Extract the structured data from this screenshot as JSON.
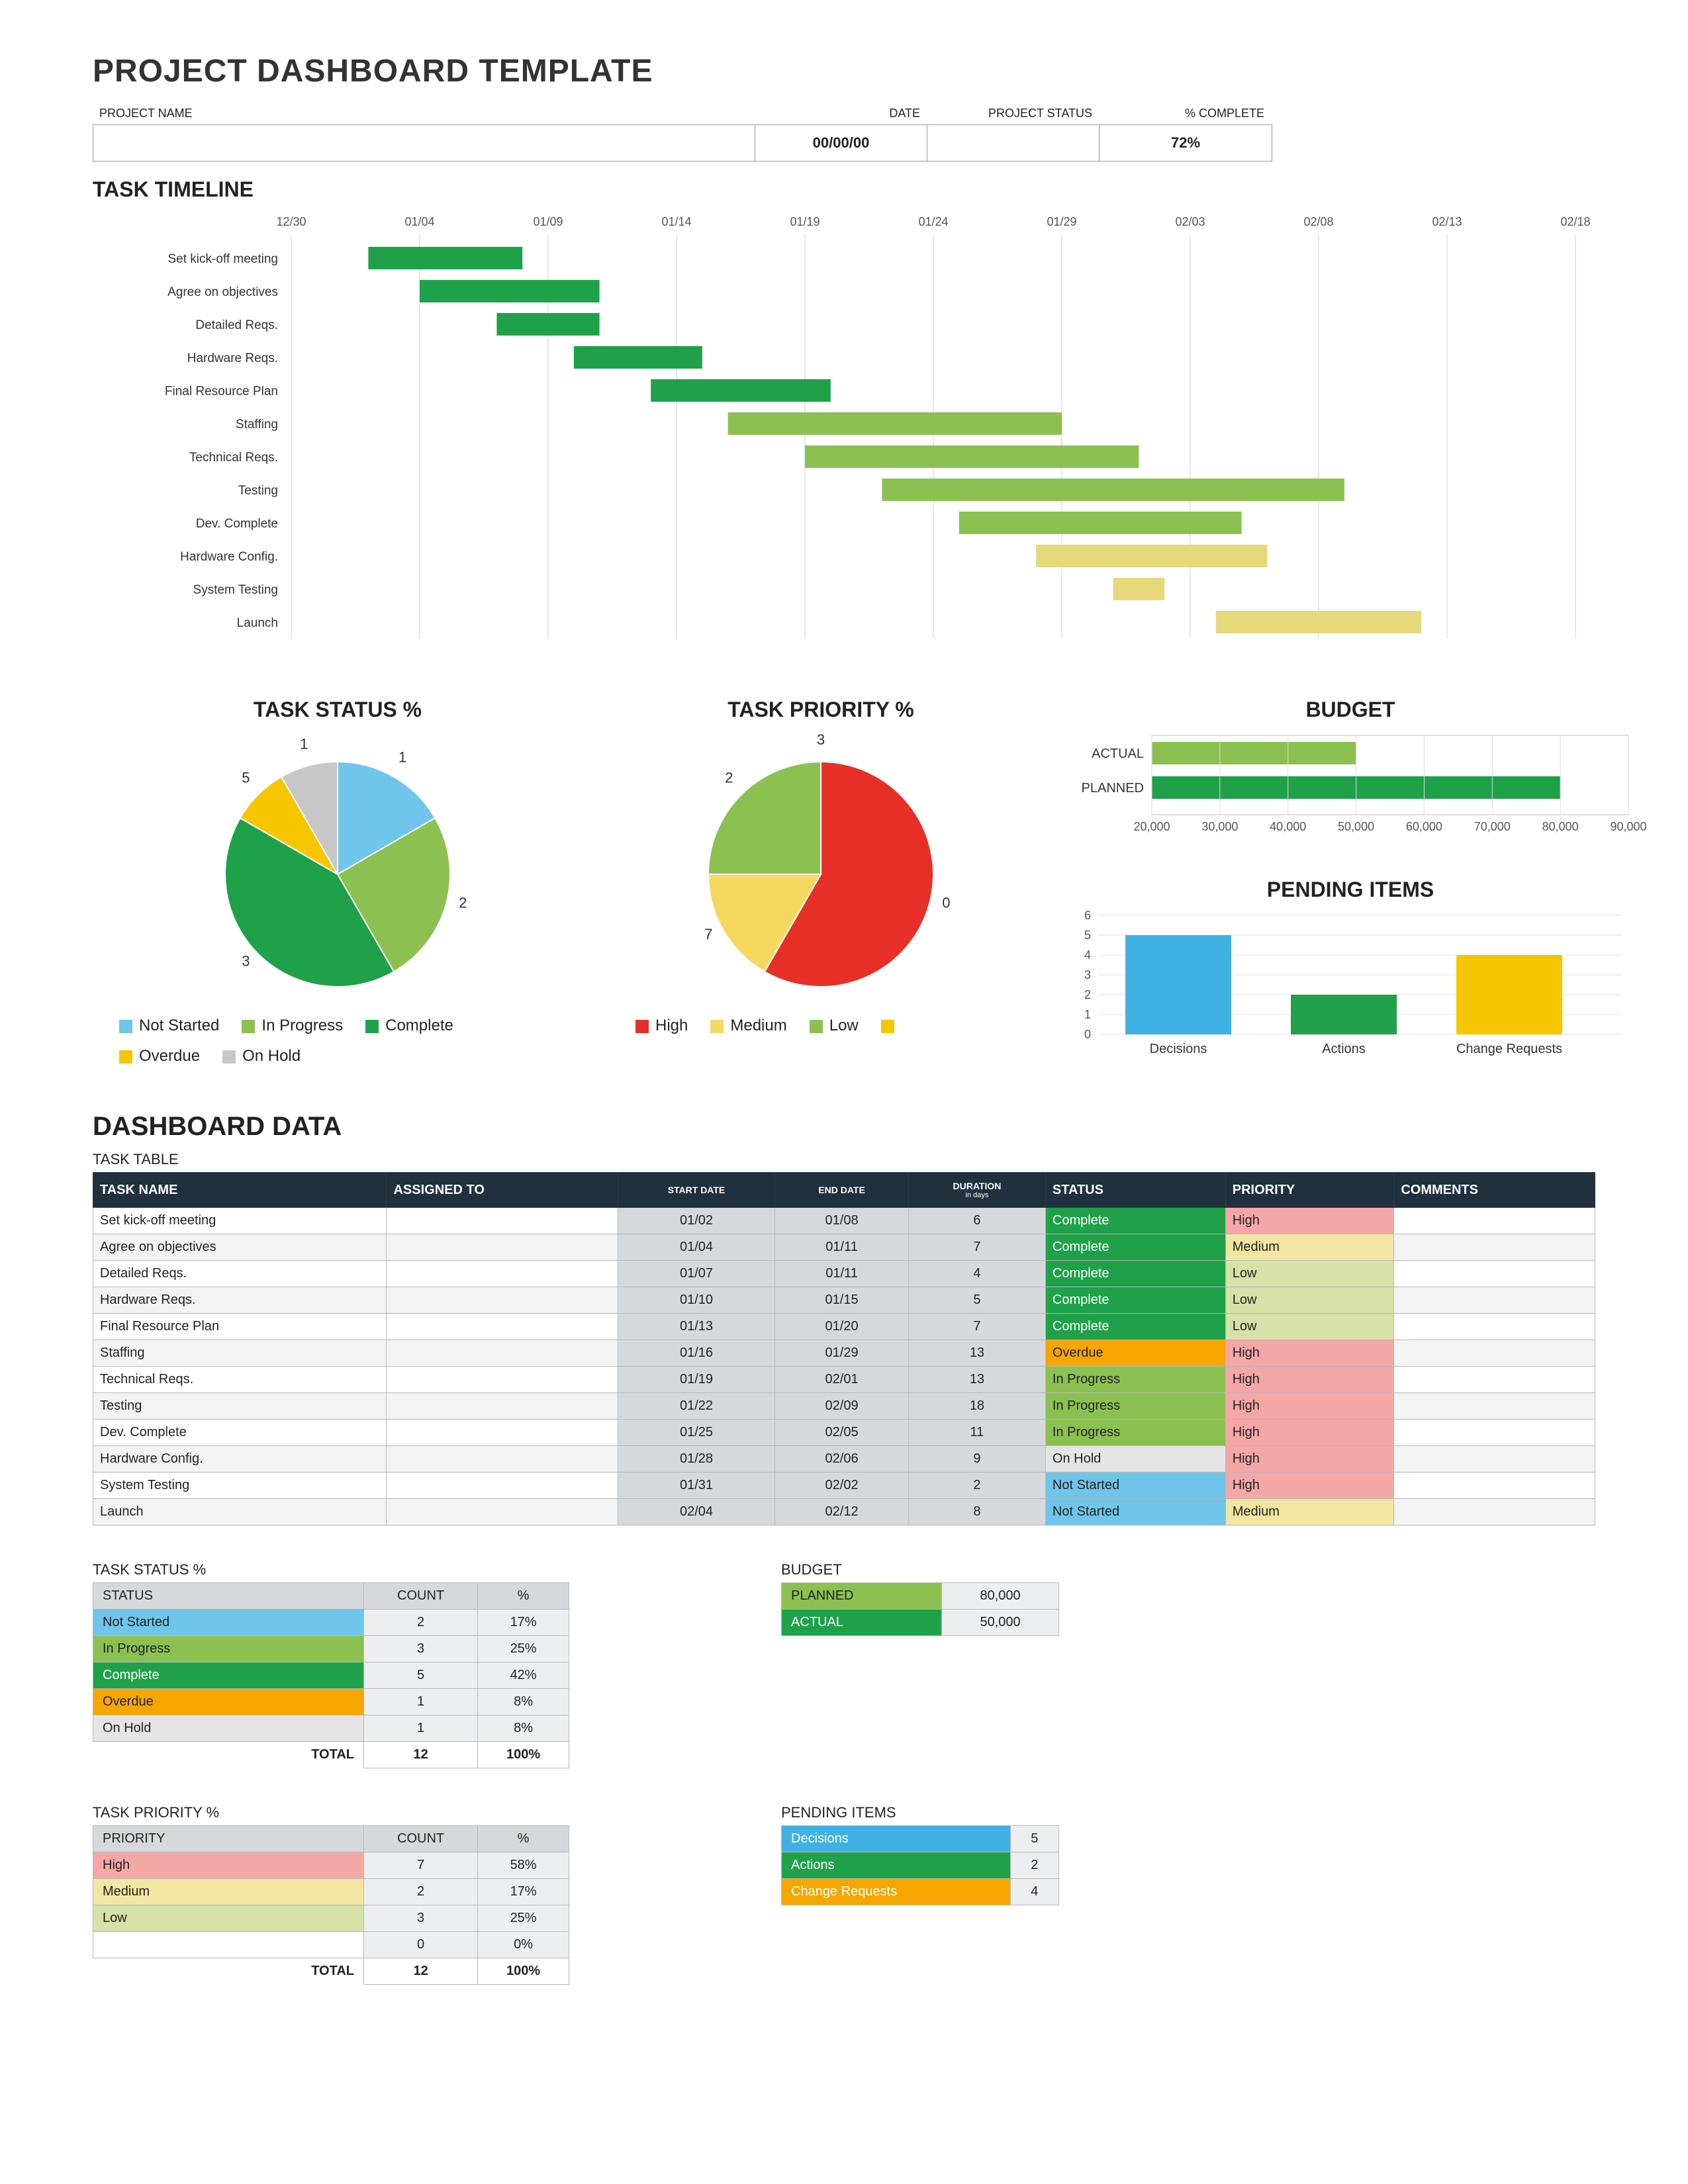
{
  "title": "PROJECT DASHBOARD TEMPLATE",
  "header_labels": {
    "name": "PROJECT NAME",
    "date": "DATE",
    "status": "PROJECT STATUS",
    "pct": "% COMPLETE"
  },
  "header_values": {
    "name": "",
    "date": "00/00/00",
    "status": "",
    "pct": "72%"
  },
  "timeline_title": "TASK TIMELINE",
  "timeline_axis": [
    "12/30",
    "01/04",
    "01/09",
    "01/14",
    "01/19",
    "01/24",
    "01/29",
    "02/03",
    "02/08",
    "02/13",
    "02/18"
  ],
  "timeline_tasks": [
    {
      "name": "Set kick-off meeting",
      "color": "#1fa14a",
      "start": "01/02",
      "end": "01/08"
    },
    {
      "name": "Agree on objectives",
      "color": "#1fa14a",
      "start": "01/04",
      "end": "01/11"
    },
    {
      "name": "Detailed Reqs.",
      "color": "#1fa14a",
      "start": "01/07",
      "end": "01/11"
    },
    {
      "name": "Hardware Reqs.",
      "color": "#1fa14a",
      "start": "01/10",
      "end": "01/15"
    },
    {
      "name": "Final Resource Plan",
      "color": "#1fa14a",
      "start": "01/13",
      "end": "01/20"
    },
    {
      "name": "Staffing",
      "color": "#8cc152",
      "start": "01/16",
      "end": "01/29"
    },
    {
      "name": "Technical Reqs.",
      "color": "#8cc152",
      "start": "01/19",
      "end": "02/01"
    },
    {
      "name": "Testing",
      "color": "#8cc152",
      "start": "01/22",
      "end": "02/09"
    },
    {
      "name": "Dev. Complete",
      "color": "#8cc152",
      "start": "01/25",
      "end": "02/05"
    },
    {
      "name": "Hardware Config.",
      "color": "#e7d87a",
      "start": "01/28",
      "end": "02/06"
    },
    {
      "name": "System Testing",
      "color": "#e7d87a",
      "start": "01/31",
      "end": "02/02"
    },
    {
      "name": "Launch",
      "color": "#e7d87a",
      "start": "02/04",
      "end": "02/12"
    }
  ],
  "status_pie_title": "TASK STATUS %",
  "status_legend": [
    {
      "label": "Not Started",
      "color": "#6fc5ea"
    },
    {
      "label": "In Progress",
      "color": "#8cc152"
    },
    {
      "label": "Complete",
      "color": "#1fa14a"
    },
    {
      "label": "Overdue",
      "color": "#f7c600"
    },
    {
      "label": "On Hold",
      "color": "#c7c7c7"
    }
  ],
  "priority_pie_title": "TASK PRIORITY %",
  "priority_legend": [
    {
      "label": "High",
      "color": "#e63027"
    },
    {
      "label": "Medium",
      "color": "#f5d95f"
    },
    {
      "label": "Low",
      "color": "#8cc152"
    },
    {
      "label": "",
      "color": "#f7c600"
    }
  ],
  "budget_title": "BUDGET",
  "pending_title": "PENDING ITEMS",
  "dashboard_data_title": "DASHBOARD DATA",
  "task_table_title": "TASK TABLE",
  "task_table_headers": [
    "TASK NAME",
    "ASSIGNED TO",
    "START DATE",
    "END DATE",
    "DURATION",
    "STATUS",
    "PRIORITY",
    "COMMENTS"
  ],
  "duration_unit": "in days",
  "task_rows": [
    {
      "name": "Set kick-off meeting",
      "assigned": "",
      "start": "01/02",
      "end": "01/08",
      "dur": "6",
      "status": "Complete",
      "priority": "High",
      "comments": ""
    },
    {
      "name": "Agree on objectives",
      "assigned": "",
      "start": "01/04",
      "end": "01/11",
      "dur": "7",
      "status": "Complete",
      "priority": "Medium",
      "comments": ""
    },
    {
      "name": "Detailed Reqs.",
      "assigned": "",
      "start": "01/07",
      "end": "01/11",
      "dur": "4",
      "status": "Complete",
      "priority": "Low",
      "comments": ""
    },
    {
      "name": "Hardware Reqs.",
      "assigned": "",
      "start": "01/10",
      "end": "01/15",
      "dur": "5",
      "status": "Complete",
      "priority": "Low",
      "comments": ""
    },
    {
      "name": "Final Resource Plan",
      "assigned": "",
      "start": "01/13",
      "end": "01/20",
      "dur": "7",
      "status": "Complete",
      "priority": "Low",
      "comments": ""
    },
    {
      "name": "Staffing",
      "assigned": "",
      "start": "01/16",
      "end": "01/29",
      "dur": "13",
      "status": "Overdue",
      "priority": "High",
      "comments": ""
    },
    {
      "name": "Technical Reqs.",
      "assigned": "",
      "start": "01/19",
      "end": "02/01",
      "dur": "13",
      "status": "In Progress",
      "priority": "High",
      "comments": ""
    },
    {
      "name": "Testing",
      "assigned": "",
      "start": "01/22",
      "end": "02/09",
      "dur": "18",
      "status": "In Progress",
      "priority": "High",
      "comments": ""
    },
    {
      "name": "Dev. Complete",
      "assigned": "",
      "start": "01/25",
      "end": "02/05",
      "dur": "11",
      "status": "In Progress",
      "priority": "High",
      "comments": ""
    },
    {
      "name": "Hardware Config.",
      "assigned": "",
      "start": "01/28",
      "end": "02/06",
      "dur": "9",
      "status": "On Hold",
      "priority": "High",
      "comments": ""
    },
    {
      "name": "System Testing",
      "assigned": "",
      "start": "01/31",
      "end": "02/02",
      "dur": "2",
      "status": "Not Started",
      "priority": "High",
      "comments": ""
    },
    {
      "name": "Launch",
      "assigned": "",
      "start": "02/04",
      "end": "02/12",
      "dur": "8",
      "status": "Not Started",
      "priority": "Medium",
      "comments": ""
    }
  ],
  "summary_status_title": "TASK STATUS %",
  "summary_status_headers": [
    "STATUS",
    "COUNT",
    "%"
  ],
  "summary_status": [
    {
      "label": "Not Started",
      "cls": "stat-NotStarted",
      "count": "2",
      "pct": "17%"
    },
    {
      "label": "In Progress",
      "cls": "stat-InProgress",
      "count": "3",
      "pct": "25%"
    },
    {
      "label": "Complete",
      "cls": "stat-Complete",
      "count": "5",
      "pct": "42%"
    },
    {
      "label": "Overdue",
      "cls": "stat-Overdue",
      "count": "1",
      "pct": "8%"
    },
    {
      "label": "On Hold",
      "cls": "stat-OnHold",
      "count": "1",
      "pct": "8%"
    }
  ],
  "summary_status_total": {
    "label": "TOTAL",
    "count": "12",
    "pct": "100%"
  },
  "summary_priority_title": "TASK PRIORITY %",
  "summary_priority_headers": [
    "PRIORITY",
    "COUNT",
    "%"
  ],
  "summary_priority": [
    {
      "label": "High",
      "cls": "pr-High",
      "count": "7",
      "pct": "58%"
    },
    {
      "label": "Medium",
      "cls": "pr-Medium",
      "count": "2",
      "pct": "17%"
    },
    {
      "label": "Low",
      "cls": "pr-Low",
      "count": "3",
      "pct": "25%"
    },
    {
      "label": "",
      "cls": "",
      "count": "0",
      "pct": "0%"
    }
  ],
  "summary_priority_total": {
    "label": "TOTAL",
    "count": "12",
    "pct": "100%"
  },
  "summary_budget_title": "BUDGET",
  "summary_budget": [
    {
      "label": "PLANNED",
      "val": "80,000",
      "cls": "stat-InProgress"
    },
    {
      "label": "ACTUAL",
      "val": "50,000",
      "cls": "stat-Complete"
    }
  ],
  "summary_pending_title": "PENDING ITEMS",
  "summary_pending": [
    {
      "label": "Decisions",
      "val": "5",
      "color": "#3fb1e5"
    },
    {
      "label": "Actions",
      "val": "2",
      "color": "#1fa14a"
    },
    {
      "label": "Change Requests",
      "val": "4",
      "color": "#f7a600"
    }
  ],
  "chart_data": [
    {
      "type": "gantt",
      "title": "TASK TIMELINE",
      "x_range": [
        "12/30",
        "02/18"
      ],
      "x_ticks": [
        "12/30",
        "01/04",
        "01/09",
        "01/14",
        "01/19",
        "01/24",
        "01/29",
        "02/03",
        "02/08",
        "02/13",
        "02/18"
      ],
      "tasks": [
        {
          "name": "Set kick-off meeting",
          "start": "01/02",
          "end": "01/08",
          "status": "Complete"
        },
        {
          "name": "Agree on objectives",
          "start": "01/04",
          "end": "01/11",
          "status": "Complete"
        },
        {
          "name": "Detailed Reqs.",
          "start": "01/07",
          "end": "01/11",
          "status": "Complete"
        },
        {
          "name": "Hardware Reqs.",
          "start": "01/10",
          "end": "01/15",
          "status": "Complete"
        },
        {
          "name": "Final Resource Plan",
          "start": "01/13",
          "end": "01/20",
          "status": "Complete"
        },
        {
          "name": "Staffing",
          "start": "01/16",
          "end": "01/29",
          "status": "In Progress"
        },
        {
          "name": "Technical Reqs.",
          "start": "01/19",
          "end": "02/01",
          "status": "In Progress"
        },
        {
          "name": "Testing",
          "start": "01/22",
          "end": "02/09",
          "status": "In Progress"
        },
        {
          "name": "Dev. Complete",
          "start": "01/25",
          "end": "02/05",
          "status": "In Progress"
        },
        {
          "name": "Hardware Config.",
          "start": "01/28",
          "end": "02/06",
          "status": "On Hold"
        },
        {
          "name": "System Testing",
          "start": "01/31",
          "end": "02/02",
          "status": "On Hold"
        },
        {
          "name": "Launch",
          "start": "02/04",
          "end": "02/12",
          "status": "Not Started"
        }
      ]
    },
    {
      "type": "pie",
      "title": "TASK STATUS %",
      "series": [
        {
          "name": "Not Started",
          "value": 2,
          "color": "#6fc5ea"
        },
        {
          "name": "In Progress",
          "value": 3,
          "color": "#8cc152"
        },
        {
          "name": "Complete",
          "value": 5,
          "color": "#1fa14a"
        },
        {
          "name": "Overdue",
          "value": 1,
          "color": "#f7c600"
        },
        {
          "name": "On Hold",
          "value": 1,
          "color": "#c7c7c7"
        }
      ],
      "data_labels": [
        1,
        2,
        3,
        5,
        1
      ]
    },
    {
      "type": "pie",
      "title": "TASK PRIORITY %",
      "series": [
        {
          "name": "High",
          "value": 7,
          "color": "#e63027"
        },
        {
          "name": "Medium",
          "value": 2,
          "color": "#f5d95f"
        },
        {
          "name": "Low",
          "value": 3,
          "color": "#8cc152"
        },
        {
          "name": "",
          "value": 0,
          "color": "#f7c600"
        }
      ],
      "data_labels": [
        0,
        7,
        2,
        3
      ]
    },
    {
      "type": "bar",
      "orientation": "horizontal",
      "title": "BUDGET",
      "categories": [
        "ACTUAL",
        "PLANNED"
      ],
      "values": [
        50000,
        80000
      ],
      "colors": [
        "#8cc152",
        "#1fa14a"
      ],
      "xlim": [
        20000,
        90000
      ],
      "x_ticks": [
        20000,
        30000,
        40000,
        50000,
        60000,
        70000,
        80000,
        90000
      ]
    },
    {
      "type": "bar",
      "title": "PENDING ITEMS",
      "categories": [
        "Decisions",
        "Actions",
        "Change Requests"
      ],
      "values": [
        5,
        2,
        4
      ],
      "colors": [
        "#3fb1e5",
        "#1fa14a",
        "#f7c600"
      ],
      "ylim": [
        0,
        6
      ],
      "y_ticks": [
        0,
        1,
        2,
        3,
        4,
        5,
        6
      ]
    }
  ]
}
